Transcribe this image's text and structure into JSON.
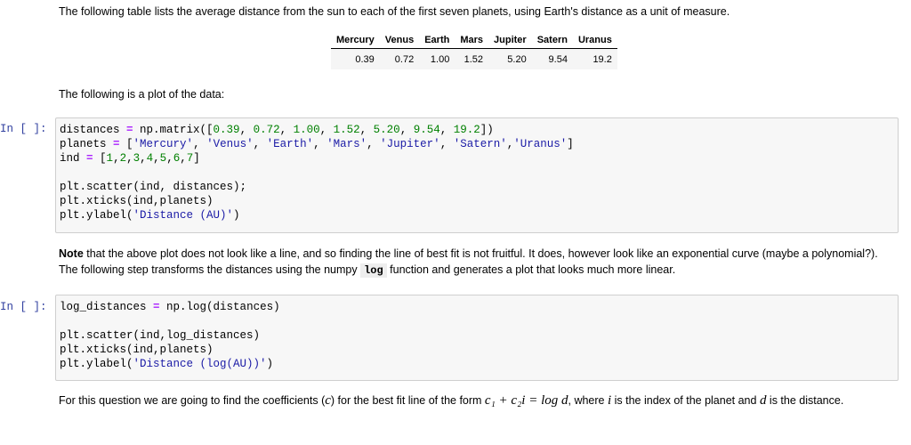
{
  "intro": "The following table lists the average distance from the sun to each of the first seven planets, using Earth's distance as a unit of measure.",
  "table": {
    "headers": [
      "Mercury",
      "Venus",
      "Earth",
      "Mars",
      "Jupiter",
      "Satern",
      "Uranus"
    ],
    "values": [
      "0.39",
      "0.72",
      "1.00",
      "1.52",
      "5.20",
      "9.54",
      "19.2"
    ]
  },
  "plot_intro": "The following is a plot of the data:",
  "cells": [
    {
      "prompt": "In [ ]:",
      "lines": [
        [
          [
            "distances ",
            "k"
          ],
          [
            "=",
            "o"
          ],
          [
            " np.matrix([",
            "k"
          ],
          [
            "0.39",
            "n"
          ],
          [
            ", ",
            "k"
          ],
          [
            "0.72",
            "n"
          ],
          [
            ", ",
            "k"
          ],
          [
            "1.00",
            "n"
          ],
          [
            ", ",
            "k"
          ],
          [
            "1.52",
            "n"
          ],
          [
            ", ",
            "k"
          ],
          [
            "5.20",
            "n"
          ],
          [
            ", ",
            "k"
          ],
          [
            "9.54",
            "n"
          ],
          [
            ", ",
            "k"
          ],
          [
            "19.2",
            "n"
          ],
          [
            "])",
            "k"
          ]
        ],
        [
          [
            "planets ",
            "k"
          ],
          [
            "=",
            "o"
          ],
          [
            " [",
            "k"
          ],
          [
            "'Mercury'",
            "s2"
          ],
          [
            ", ",
            "k"
          ],
          [
            "'Venus'",
            "s2"
          ],
          [
            ", ",
            "k"
          ],
          [
            "'Earth'",
            "s2"
          ],
          [
            ", ",
            "k"
          ],
          [
            "'Mars'",
            "s2"
          ],
          [
            ", ",
            "k"
          ],
          [
            "'Jupiter'",
            "s2"
          ],
          [
            ", ",
            "k"
          ],
          [
            "'Satern'",
            "s2"
          ],
          [
            ",",
            "k"
          ],
          [
            "'Uranus'",
            "s2"
          ],
          [
            "]",
            "k"
          ]
        ],
        [
          [
            "ind ",
            "k"
          ],
          [
            "=",
            "o"
          ],
          [
            " [",
            "k"
          ],
          [
            "1",
            "n"
          ],
          [
            ",",
            "k"
          ],
          [
            "2",
            "n"
          ],
          [
            ",",
            "k"
          ],
          [
            "3",
            "n"
          ],
          [
            ",",
            "k"
          ],
          [
            "4",
            "n"
          ],
          [
            ",",
            "k"
          ],
          [
            "5",
            "n"
          ],
          [
            ",",
            "k"
          ],
          [
            "6",
            "n"
          ],
          [
            ",",
            "k"
          ],
          [
            "7",
            "n"
          ],
          [
            "]",
            "k"
          ]
        ],
        [],
        [
          [
            "plt.scatter(ind, distances);",
            "k"
          ]
        ],
        [
          [
            "plt.xticks(ind,planets)",
            "k"
          ]
        ],
        [
          [
            "plt.ylabel(",
            "k"
          ],
          [
            "'Distance (AU)'",
            "s2"
          ],
          [
            ")",
            "k"
          ]
        ]
      ]
    },
    {
      "prompt": "In [ ]:",
      "lines": [
        [
          [
            "log_distances ",
            "k"
          ],
          [
            "=",
            "o"
          ],
          [
            " np.log(distances)",
            "k"
          ]
        ],
        [],
        [
          [
            "plt.scatter(ind,log_distances)",
            "k"
          ]
        ],
        [
          [
            "plt.xticks(ind,planets)",
            "k"
          ]
        ],
        [
          [
            "plt.ylabel(",
            "k"
          ],
          [
            "'Distance (log(AU))'",
            "s2"
          ],
          [
            ")",
            "k"
          ]
        ]
      ]
    }
  ],
  "note": {
    "bold": "Note",
    "text1": " that the above plot does not look like a line, and so finding the line of best fit is not fruitful. It does, however look like an exponential curve (maybe a polynomial?). The following step transforms the distances using the numpy ",
    "code": "log",
    "text2": " function and generates a plot that looks much more linear."
  },
  "final": {
    "text1": "For this question we are going to find the coefficients (",
    "c": "c",
    "text2": ") for the best fit line of the form ",
    "formula": "c₁ + c₂i = log d",
    "text3": ", where ",
    "i": "i",
    "text4": " is the index of the planet and ",
    "d": "d",
    "text5": " is the distance."
  }
}
